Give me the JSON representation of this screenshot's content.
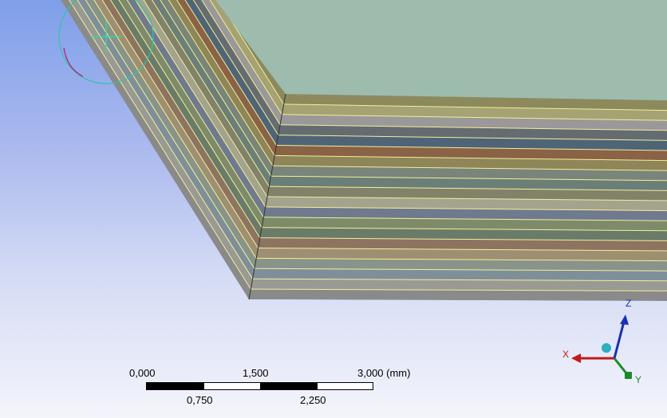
{
  "viewport": {
    "background_top": "#7f9fea",
    "background_bottom": "#f4f5fb"
  },
  "model": {
    "top_face_color": "#9dbcad",
    "layer_line_color": "#f2ef9a",
    "layer_colors": [
      "#8c8a5c",
      "#a5a274",
      "#9a9898",
      "#646c72",
      "#4f6476",
      "#8a6246",
      "#8e8658",
      "#79847a",
      "#6b7f78",
      "#82826a",
      "#a4a38e",
      "#6f7a8e",
      "#7d8b6a",
      "#6a7b6a",
      "#8c7460",
      "#9f8f72",
      "#88938a",
      "#7f8f9a",
      "#999a94",
      "#8a8a8a"
    ]
  },
  "scale_bar": {
    "top_labels": [
      "0,000",
      "1,500",
      "3,000 (mm)"
    ],
    "bottom_labels": [
      "0,750",
      "2,250"
    ]
  },
  "triad": {
    "x_label": "X",
    "y_label": "Y",
    "z_label": "Z",
    "x_color": "#c01a1a",
    "y_color": "#1a8a2a",
    "z_color": "#1a30b0",
    "iso_color": "#2ab0c0"
  }
}
